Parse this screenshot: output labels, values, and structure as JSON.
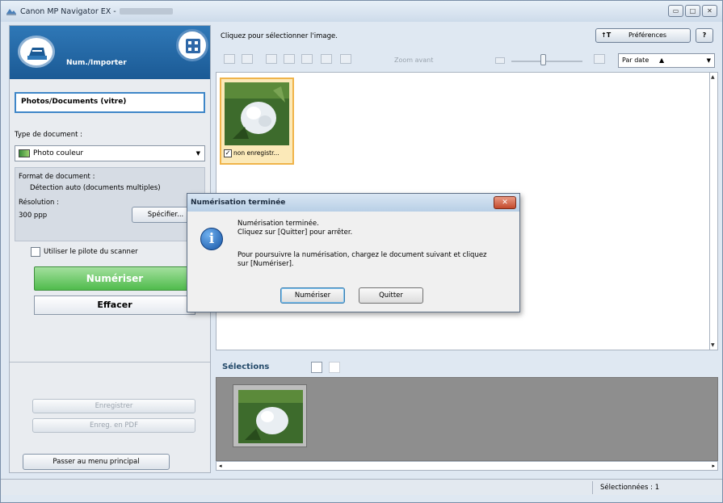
{
  "window": {
    "title": "Canon MP Navigator EX -",
    "controls": [
      "minimize",
      "maximize",
      "close"
    ]
  },
  "left_panel": {
    "mode_label": "Num./Importer",
    "source_button": "Photos/Documents (vitre)",
    "doc_type_label": "Type de document :",
    "doc_type_value": "Photo couleur",
    "doc_format_label": "Format de document :",
    "doc_format_value": "Détection auto (documents multiples)",
    "resolution_label": "Résolution :",
    "resolution_value": "300 ppp",
    "specify_button": "Spécifier...",
    "use_driver_label": "Utiliser le pilote du scanner",
    "use_driver_checked": false,
    "scan_button": "Numériser",
    "clear_button": "Effacer",
    "save_button": "Enregistrer",
    "save_pdf_button": "Enreg. en PDF",
    "main_menu_button": "Passer au menu principal"
  },
  "right_panel": {
    "instruction": "Cliquez pour sélectionner l'image.",
    "preferences_button": "Préférences",
    "help_button": "?",
    "zoom_label": "Zoom avant",
    "sort_value": "Par date",
    "thumbnail_name": "non enregistr...",
    "thumbnail_checked": true,
    "selections_title": "Sélections"
  },
  "status": {
    "selected": "Sélectionnées : 1"
  },
  "dialog": {
    "title": "Numérisation terminée",
    "line1": "Numérisation terminée.",
    "line2": "Cliquez sur [Quitter] pour arrêter.",
    "line3": "Pour poursuivre la numérisation, chargez le document suivant et cliquez",
    "line4": "sur [Numériser].",
    "scan_button": "Numériser",
    "quit_button": "Quitter"
  },
  "colors": {
    "accent_blue": "#2f78b7",
    "scan_green": "#4fbb4c",
    "thumb_highlight": "#f0b44a"
  }
}
